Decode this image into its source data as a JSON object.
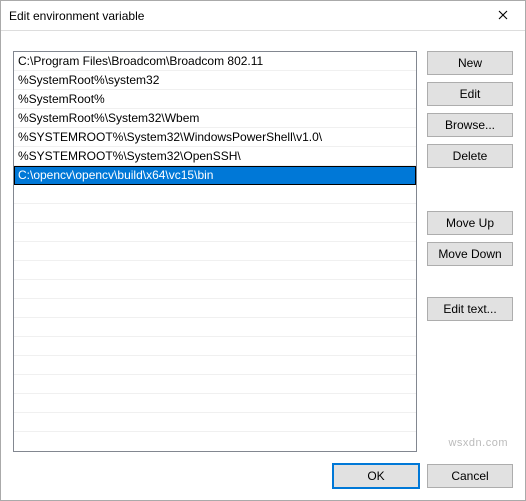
{
  "window": {
    "title": "Edit environment variable"
  },
  "list": {
    "items": [
      {
        "text": "C:\\Program Files\\Broadcom\\Broadcom 802.11",
        "selected": false
      },
      {
        "text": "%SystemRoot%\\system32",
        "selected": false
      },
      {
        "text": "%SystemRoot%",
        "selected": false
      },
      {
        "text": "%SystemRoot%\\System32\\Wbem",
        "selected": false
      },
      {
        "text": "%SYSTEMROOT%\\System32\\WindowsPowerShell\\v1.0\\",
        "selected": false
      },
      {
        "text": "%SYSTEMROOT%\\System32\\OpenSSH\\",
        "selected": false
      },
      {
        "text": "C:\\opencv\\opencv\\build\\x64\\vc15\\bin",
        "selected": true
      }
    ],
    "empty_rows": 13
  },
  "buttons": {
    "new": "New",
    "edit": "Edit",
    "browse": "Browse...",
    "delete": "Delete",
    "move_up": "Move Up",
    "move_down": "Move Down",
    "edit_text": "Edit text...",
    "ok": "OK",
    "cancel": "Cancel"
  },
  "watermark": "wsxdn.com"
}
